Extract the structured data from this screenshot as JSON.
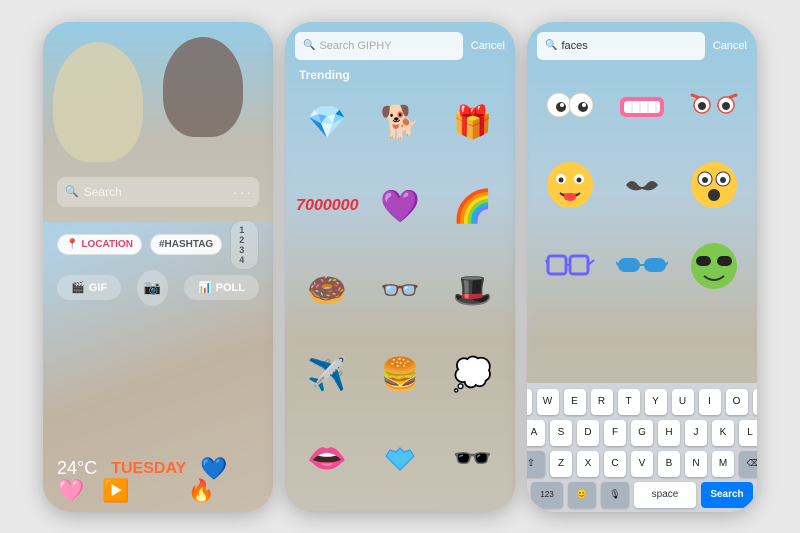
{
  "phones": [
    {
      "id": "phone1",
      "search_placeholder": "Search",
      "stickers": [
        "LOCATION",
        "#HASHTAG",
        "1 2  3 4"
      ],
      "tools": [
        "GIF",
        "POLL"
      ],
      "weather": "24°C",
      "day": "TUESDAY"
    },
    {
      "id": "phone2",
      "search_placeholder": "Search GIPHY",
      "cancel_label": "Cancel",
      "trending_label": "Trending",
      "stickers": [
        "💎",
        "🐶",
        "🎁",
        "7000000",
        "💜",
        "🌈",
        "🍩",
        "👓",
        "🎩",
        "✈️",
        "🍔",
        "💭",
        "👄",
        "💙",
        "🕶️"
      ]
    },
    {
      "id": "phone3",
      "search_value": "faces",
      "cancel_label": "Cancel",
      "keyboard": {
        "rows": [
          [
            "Q",
            "W",
            "E",
            "R",
            "T",
            "Y",
            "U",
            "I",
            "O",
            "P"
          ],
          [
            "A",
            "S",
            "D",
            "F",
            "G",
            "H",
            "J",
            "K",
            "L"
          ],
          [
            "⇧",
            "Z",
            "X",
            "C",
            "V",
            "B",
            "N",
            "M",
            "⌫"
          ]
        ],
        "bottom": [
          "123",
          "😊",
          "🎙",
          "space",
          "Search"
        ]
      }
    }
  ]
}
